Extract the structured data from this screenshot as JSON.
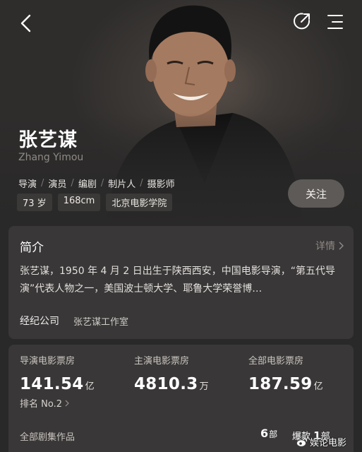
{
  "header": {
    "back_icon": "chevron-left-icon",
    "share_icon": "share-icon",
    "menu_icon": "menu-icon"
  },
  "profile": {
    "name": "张艺谋",
    "name_en": "Zhang Yimou",
    "roles": [
      "导演",
      "演员",
      "编剧",
      "制片人",
      "摄影师"
    ],
    "age": "73 岁",
    "height": "168cm",
    "school": "北京电影学院",
    "follow_label": "关注"
  },
  "intro": {
    "title": "简介",
    "detail_label": "详情",
    "text": "张艺谋，1950 年 4 月 2 日出生于陕西西安，中国电影导演，“第五代导演”代表人物之一，美国波士顿大学、耶鲁大学荣誉博…",
    "agency_label": "经纪公司",
    "agency_value": "张艺谋工作室"
  },
  "box_office": {
    "directed": {
      "label": "导演电影票房",
      "value": "141.54",
      "unit": "亿"
    },
    "rank_label": "排名 No.2",
    "starred": {
      "label": "主演电影票房",
      "value": "4810.3",
      "unit": "万"
    },
    "all": {
      "label": "全部电影票房",
      "value": "187.59",
      "unit": "亿"
    },
    "works_label": "全部剧集作品",
    "works_count": "6",
    "works_unit": "部",
    "hit_label": "爆款",
    "hit_count": "1",
    "hit_unit": "部"
  },
  "watermark": {
    "text": "娱论电影",
    "icon": "weibo-icon"
  },
  "colors": {
    "background": "#2a2929",
    "card": "#393737",
    "muted": "#8e8985"
  }
}
